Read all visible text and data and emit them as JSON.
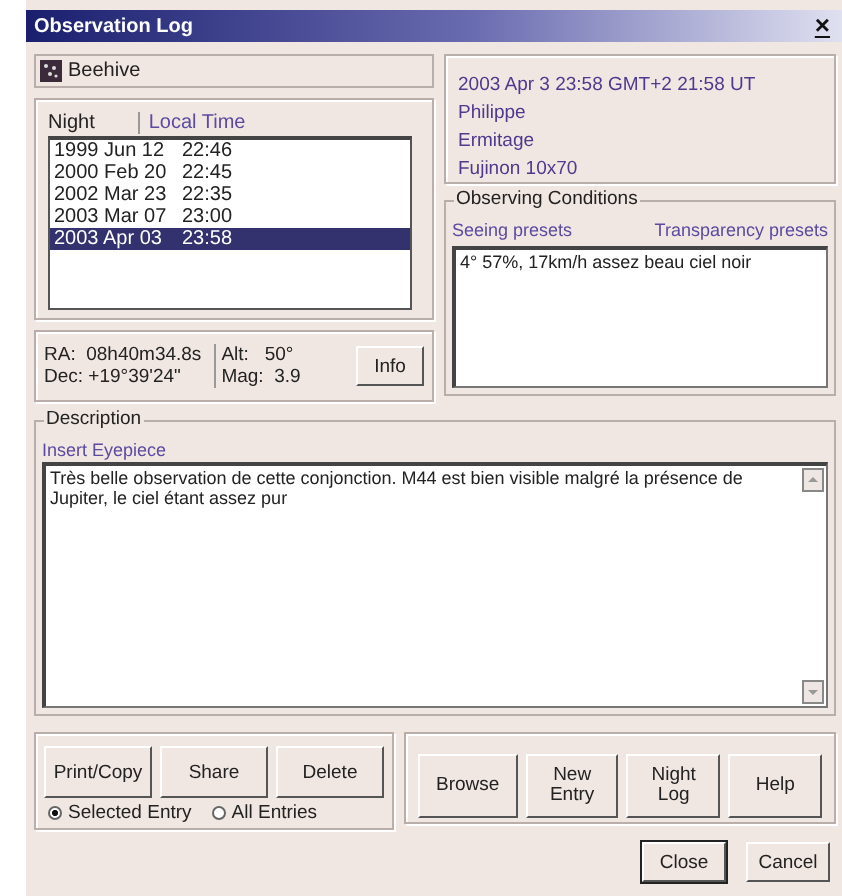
{
  "window": {
    "title": "Observation Log",
    "close": "×"
  },
  "object": {
    "name": "Beehive"
  },
  "night_list": {
    "columns": [
      "Night",
      "Local Time"
    ],
    "rows": [
      {
        "night": "1999 Jun 12",
        "time": "22:46",
        "selected": false
      },
      {
        "night": "2000 Feb 20",
        "time": "22:45",
        "selected": false
      },
      {
        "night": "2002 Mar 23",
        "time": "22:35",
        "selected": false
      },
      {
        "night": "2003 Mar 07",
        "time": "23:00",
        "selected": false
      },
      {
        "night": "2003 Apr 03",
        "time": "23:58",
        "selected": true
      }
    ]
  },
  "info": {
    "lines": [
      "2003 Apr 3 23:58 GMT+2 21:58 UT",
      "Philippe",
      "Ermitage",
      "Fujinon 10x70"
    ]
  },
  "position": {
    "ra_label": "RA:",
    "ra": "08h40m34.8s",
    "dec_label": "Dec:",
    "dec": "+19°39'24\"",
    "alt_label": "Alt:",
    "alt": "50°",
    "mag_label": "Mag:",
    "mag": "3.9",
    "button": "Info"
  },
  "conditions": {
    "title": "Observing Conditions",
    "links": [
      "Seeing presets",
      "Transparency presets"
    ],
    "value": "4° 57%, 17km/h assez beau ciel noir"
  },
  "description": {
    "title": "Description",
    "link": "Insert Eyepiece",
    "value": "Très belle observation de cette conjonction. M44 est bien visible malgré la présence de Jupiter, le ciel étant assez pur"
  },
  "entry_actions": {
    "buttons": [
      "Print/Copy",
      "Share",
      "Delete"
    ],
    "scope": [
      {
        "label": "Selected Entry",
        "selected": true
      },
      {
        "label": "All Entries",
        "selected": false
      }
    ]
  },
  "nav_buttons": [
    "Browse",
    "New Entry",
    "Night Log",
    "Help"
  ],
  "dialog_buttons": [
    {
      "label": "Close",
      "default": true
    },
    {
      "label": "Cancel",
      "default": false
    }
  ]
}
